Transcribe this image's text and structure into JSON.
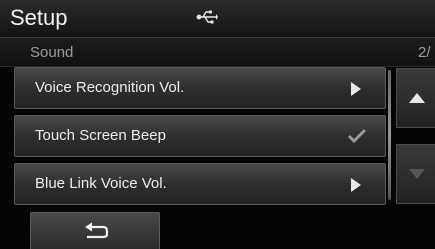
{
  "header": {
    "title": "Setup",
    "usb_icon": "usb-icon"
  },
  "subheader": {
    "section": "Sound",
    "page_indicator": "2/"
  },
  "menu": {
    "items": [
      {
        "label": "Voice Recognition Vol.",
        "control": "arrow-right-icon"
      },
      {
        "label": "Touch Screen Beep",
        "control": "checkmark-icon",
        "checked": true
      },
      {
        "label": "Blue Link Voice Vol.",
        "control": "arrow-right-icon"
      }
    ]
  },
  "scroll": {
    "up_icon": "triangle-up-icon",
    "down_icon": "triangle-down-icon",
    "down_enabled": false
  },
  "footer": {
    "back_icon": "back-arrow-icon"
  },
  "colors": {
    "text": "#ededed",
    "muted": "#9c9c9c",
    "background": "#050505"
  }
}
